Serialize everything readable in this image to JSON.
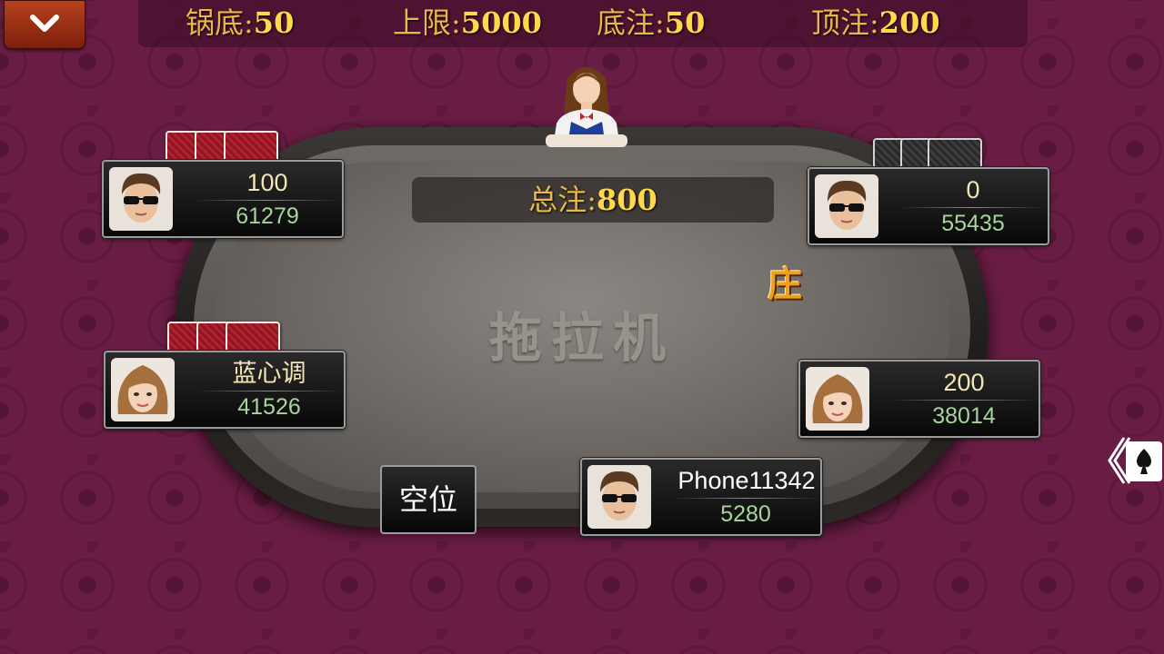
{
  "info_bar": {
    "pot_base_label": "锅底:",
    "pot_base_value": "50",
    "limit_label": "上限:",
    "limit_value": "5000",
    "ante_label": "底注:",
    "ante_value": "50",
    "cap_label": "顶注:",
    "cap_value": "200"
  },
  "table": {
    "total_bet_label": "总注:",
    "total_bet_value": "800",
    "game_name": "拖拉机",
    "banker_label": "庄"
  },
  "players": {
    "top_left": {
      "top_text": "100",
      "chips": "61279"
    },
    "top_right": {
      "top_text": "0",
      "chips": "55435"
    },
    "mid_left": {
      "top_text": "蓝心调",
      "chips": "41526"
    },
    "mid_right": {
      "top_text": "200",
      "chips": "38014"
    },
    "self": {
      "top_text": "Phone11342",
      "chips": "5280"
    }
  },
  "empty_seat_label": "空位",
  "icons": {
    "menu": "chevron-down-icon",
    "side": "card-spade-icon"
  },
  "colors": {
    "background": "#6a1d44",
    "gold_text": "#ffd94a",
    "chip_text": "#a6d49a",
    "menu_button": "#b8421d"
  }
}
